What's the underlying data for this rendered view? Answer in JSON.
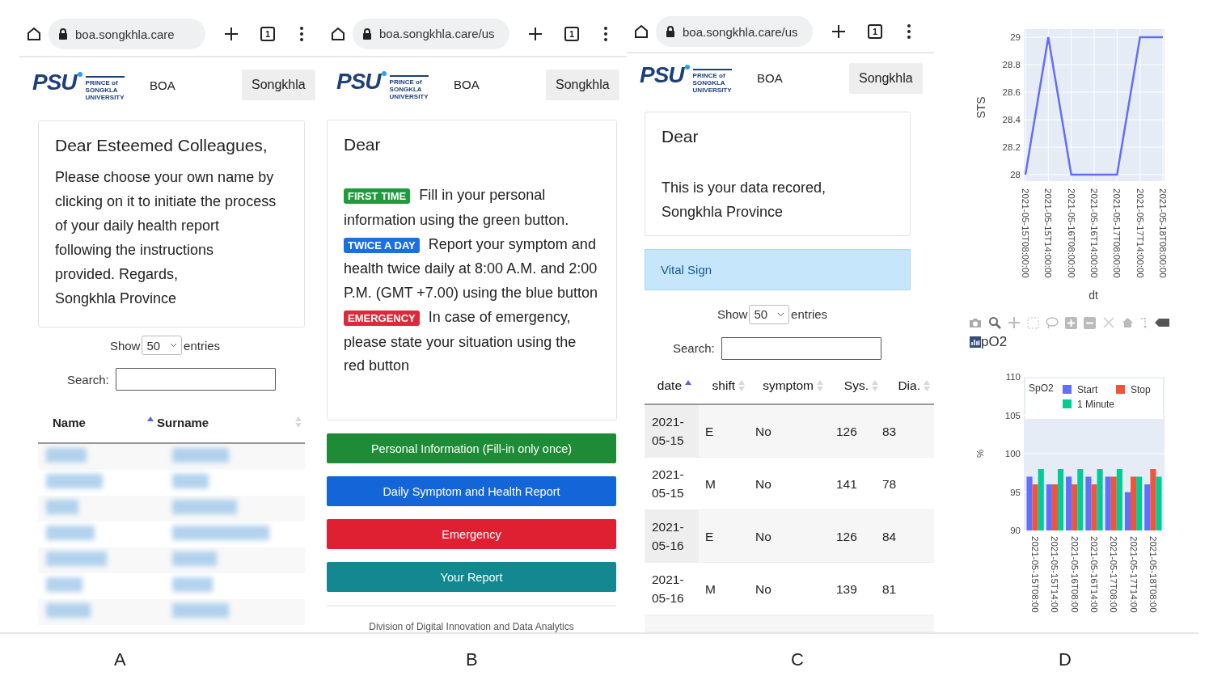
{
  "panels": [
    {
      "label": "A",
      "kind": "name-list",
      "browser": {
        "url": "boa.songkhla.care",
        "tab_count": "1"
      },
      "nav": {
        "logo": "PSU",
        "logo_sub": "PRINCE of SONGKLA UNIVERSITY",
        "brand": "BOA",
        "button": "Songkhla"
      },
      "card": {
        "heading": "Dear Esteemed Colleagues,",
        "lines": [
          "Please choose your own name by clicking on it to initiate the process of your daily health report following the instructions provided. Regards,",
          "Songkhla Province"
        ]
      },
      "table": {
        "show": "Show",
        "entries_value": "50",
        "entries": "entries",
        "search_label": "Search:",
        "columns": [
          {
            "label": "Name",
            "sorted": true
          },
          {
            "label": "Surname",
            "sorted": false
          }
        ]
      }
    },
    {
      "label": "B",
      "kind": "menu",
      "browser": {
        "url": "boa.songkhla.care/us",
        "tab_count": "1"
      },
      "nav": {
        "logo": "PSU",
        "logo_sub": "PRINCE of SONGKLA UNIVERSITY",
        "brand": "BOA",
        "button": "Songkhla"
      },
      "card": {
        "heading": "Dear",
        "instructions": [
          {
            "badge": "FIRST TIME",
            "color": "#1e9b3c",
            "text": "Fill in your personal information using the green button."
          },
          {
            "badge": "TWICE A DAY",
            "color": "#1b6fe0",
            "text": "Report your symptom and health twice daily at 8:00 A.M. and 2:00 P.M. (GMT +7.00) using the blue button"
          },
          {
            "badge": "EMERGENCY",
            "color": "#e0283a",
            "text": "In case of emergency, please state your situation using the red button"
          }
        ]
      },
      "buttons": [
        {
          "label": "Personal Information (Fill-in only once)",
          "color": "#1e8c36"
        },
        {
          "label": "Daily Symptom and Health Report",
          "color": "#1466d8"
        },
        {
          "label": "Emergency",
          "color": "#df1f32"
        },
        {
          "label": "Your Report",
          "color": "#138890"
        }
      ],
      "footer": "Division of Digital Innovation and Data Analytics"
    },
    {
      "label": "C",
      "kind": "records",
      "browser": {
        "url": "boa.songkhla.care/us",
        "tab_count": "1"
      },
      "nav": {
        "logo": "PSU",
        "logo_sub": "PRINCE of SONGKLA UNIVERSITY",
        "brand": "BOA",
        "button": "Songkhla"
      },
      "card": {
        "heading": "Dear",
        "lines": [
          "This is your data recored,",
          "Songkhla Province"
        ]
      },
      "section": "Vital Sign",
      "table": {
        "show": "Show",
        "entries_value": "50",
        "entries": "entries",
        "search_label": "Search:",
        "columns": [
          {
            "label": "date",
            "sorted": true
          },
          {
            "label": "shift",
            "sorted": false
          },
          {
            "label": "symptom",
            "sorted": false
          },
          {
            "label": "Sys.",
            "sorted": false
          },
          {
            "label": "Dia.",
            "sorted": false
          }
        ],
        "rows": [
          [
            "2021-05-15",
            "E",
            "No",
            "126",
            "83"
          ],
          [
            "2021-05-15",
            "M",
            "No",
            "141",
            "78"
          ],
          [
            "2021-05-16",
            "E",
            "No",
            "126",
            "84"
          ],
          [
            "2021-05-16",
            "M",
            "No",
            "139",
            "81"
          ]
        ]
      }
    },
    {
      "label": "D",
      "kind": "charts",
      "line_chart": {
        "chart_data": {
          "type": "line",
          "xlabel": "dt",
          "ylabel": "STS",
          "categories": [
            "2021-05-15T08:00:00",
            "2021-05-15T14:00:00",
            "2021-05-16T08:00:00",
            "2021-05-16T14:00:00",
            "2021-05-17T08:00:00",
            "2021-05-17T14:00:00",
            "2021-05-18T08:00:00"
          ],
          "series": [
            {
              "color": "#636efa",
              "values": [
                28,
                29,
                28,
                28,
                28,
                29,
                29
              ]
            }
          ],
          "grid": true,
          "ylim": [
            28,
            29
          ],
          "yticks": [
            28,
            28.2,
            28.4,
            28.6,
            28.8,
            29
          ]
        }
      },
      "bar_title": "pO2",
      "bar_chart": {
        "chart_data": {
          "type": "bar",
          "ylabel": "%",
          "categories": [
            "2021-05-15T08:00",
            "2021-05-15T14:00",
            "2021-05-16T08:00",
            "2021-05-16T14:00",
            "2021-05-17T08:00",
            "2021-05-17T14:00",
            "2021-05-18T08:00"
          ],
          "grid": true,
          "legend": "inside-top",
          "legend_title": "SpO2",
          "series": [
            {
              "name": "Start",
              "color": "#636efa",
              "values": [
                97,
                96,
                97,
                97,
                97,
                95,
                96
              ]
            },
            {
              "name": "Stop",
              "color": "#ef553b",
              "values": [
                96,
                96,
                96,
                96,
                97,
                97,
                98
              ]
            },
            {
              "name": "1 Minute",
              "color": "#00cc96",
              "values": [
                98,
                98,
                98,
                98,
                98,
                97,
                97
              ]
            }
          ],
          "ylim": [
            90,
            110
          ],
          "yticks": [
            90,
            95,
            100,
            105,
            110
          ]
        }
      }
    }
  ]
}
